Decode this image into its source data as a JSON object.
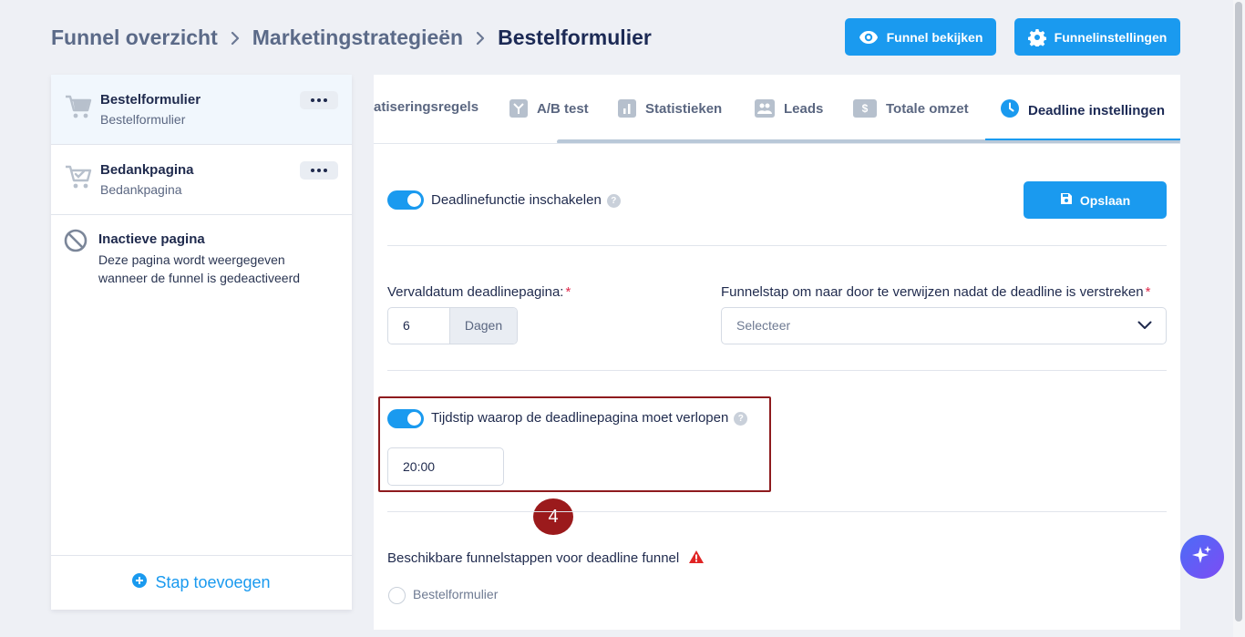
{
  "breadcrumb": [
    "Funnel overzicht",
    "Marketingstrategieën",
    "Bestelformulier"
  ],
  "header": {
    "view_label": "Funnel bekijken",
    "settings_label": "Funnelinstellingen"
  },
  "sidebar": {
    "items": [
      {
        "title": "Bestelformulier",
        "subtitle": "Bestelformulier"
      },
      {
        "title": "Bedankpagina",
        "subtitle": "Bedankpagina"
      }
    ],
    "inactive": {
      "title": "Inactieve pagina",
      "description": "Deze pagina wordt weergegeven wanneer de funnel is gedeactiveerd"
    },
    "add_step_label": "Stap toevoegen"
  },
  "tabs": [
    {
      "label": "atiseringsregels",
      "icon": ""
    },
    {
      "label": "A/B test",
      "icon": "split-icon"
    },
    {
      "label": "Statistieken",
      "icon": "bar-chart-icon"
    },
    {
      "label": "Leads",
      "icon": "users-icon"
    },
    {
      "label": "Totale omzet",
      "icon": "dollar-icon"
    },
    {
      "label": "Deadline instellingen",
      "icon": "clock-icon"
    }
  ],
  "deadline": {
    "enable_label": "Deadlinefunctie inschakelen",
    "save_label": "Opslaan",
    "expiry_label": "Vervaldatum deadlinepagina:",
    "expiry_value": "6",
    "expiry_unit": "Dagen",
    "redirect_label": "Funnelstap om naar door te verwijzen nadat de deadline is verstreken",
    "redirect_placeholder": "Selecteer",
    "time_label": "Tijdstip waarop de deadlinepagina moet verlopen",
    "time_value": "20:00",
    "available_label": "Beschikbare funnelstappen voor deadline funnel",
    "available_option": "Bestelformulier"
  },
  "annotation": {
    "step": "4"
  },
  "colors": {
    "accent": "#1a9aef",
    "highlight": "#8e1b1e",
    "warning": "#e02424"
  }
}
